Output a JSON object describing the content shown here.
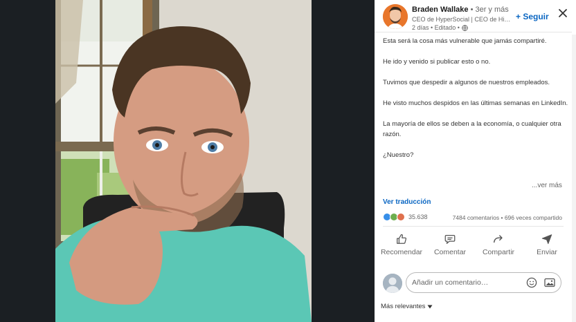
{
  "post": {
    "author_name": "Braden Wallake",
    "author_degree": " • 3er y más",
    "headline": "CEO de HyperSocial | CEO de Hipe...",
    "timestamp": "2 días • Editado •",
    "follow_label": "+ Seguir",
    "paragraphs": [
      "Esta será la cosa más vulnerable que jamás compartiré.",
      "He ido y venido si publicar esto o no.",
      "Tuvimos que despedir a algunos de nuestros empleados.",
      "He visto muchos despidos en las últimas semanas en LinkedIn.",
      "La mayoría de ellos se deben a la economía, o cualquier otra razón.",
      "¿Nuestro?"
    ],
    "see_more": "...ver más",
    "translation": "Ver traducción",
    "reaction_count": "35.638",
    "social_counts": "7484 comentarios • 696 veces compartido"
  },
  "actions": {
    "like": "Recomendar",
    "comment": "Comentar",
    "share": "Compartir",
    "send": "Enviar"
  },
  "comment_box": {
    "placeholder": "Añadir un comentario…"
  },
  "sort": {
    "label": "Más relevantes"
  },
  "colors": {
    "link_blue": "#0a66c2",
    "like_blue": "#378fe9",
    "celebrate_green": "#6dae4f",
    "love_red": "#df704d"
  },
  "icons": [
    "close-icon",
    "globe-icon",
    "like-icon",
    "comment-icon",
    "share-icon",
    "send-icon",
    "emoji-icon",
    "image-icon",
    "caret-down-icon"
  ]
}
